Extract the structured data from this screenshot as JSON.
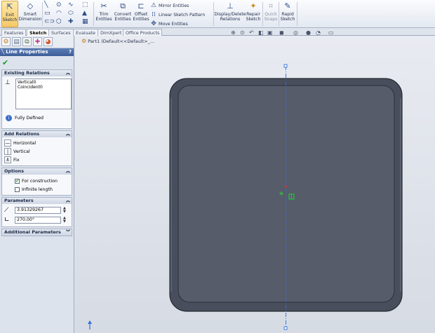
{
  "ribbon": {
    "exit_sketch": [
      "Exit",
      "Sketch"
    ],
    "smart_dimension": [
      "Smart",
      "Dimension"
    ],
    "trim_entities": [
      "Trim",
      "Entities"
    ],
    "convert_entities": [
      "Convert",
      "Entities"
    ],
    "offset_entities": [
      "Offset",
      "Entities"
    ],
    "mirror_entities": "Mirror Entities",
    "linear_pattern": "Linear Sketch Pattern",
    "move_entities": "Move Entities",
    "display_delete_relations": [
      "Display/Delete",
      "Relations"
    ],
    "repair_sketch": [
      "Repair",
      "Sketch"
    ],
    "quick_snaps": [
      "Quick",
      "Snaps"
    ],
    "rapid_sketch": [
      "Rapid",
      "Sketch"
    ]
  },
  "tabs": [
    "Features",
    "Sketch",
    "Surfaces",
    "Evaluate",
    "DimXpert",
    "Office Products"
  ],
  "active_tab": "Sketch",
  "tree": {
    "label": "Part1  (Default<<Default>_..."
  },
  "panel": {
    "title": "Line Properties",
    "help": "?",
    "existing_relations": {
      "header": "Existing Relations",
      "items": [
        "Vertical0",
        "Coincident0"
      ],
      "status": "Fully Defined"
    },
    "add_relations": {
      "header": "Add Relations",
      "items": [
        "Horizontal",
        "Vertical",
        "Fix"
      ]
    },
    "options": {
      "header": "Options",
      "for_construction": "For construction",
      "infinite_length": "Infinite length"
    },
    "parameters": {
      "header": "Parameters",
      "length": "3.91329267",
      "angle": "270.00°"
    },
    "additional_parameters": {
      "header": "Additional Parameters"
    }
  },
  "colors": {
    "part_fill": "#4d5361",
    "part_face": "#555b69",
    "part_edge": "#2a2e37",
    "centerline": "#2f6fd6",
    "accent_title": "#4a6ca8",
    "ok_green": "#1d9c24"
  }
}
